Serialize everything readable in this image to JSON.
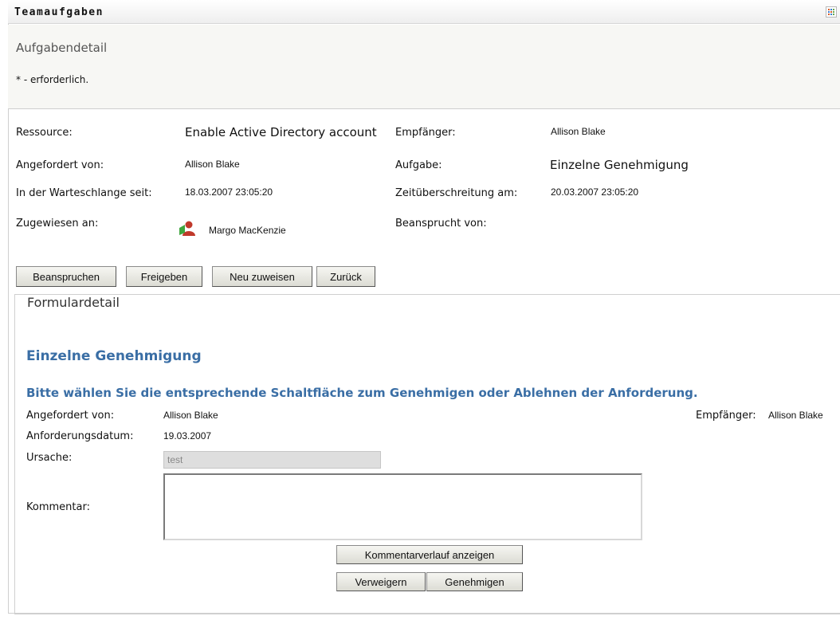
{
  "window": {
    "title": "Teamaufgaben",
    "menu_icon": "grid-menu-icon"
  },
  "header": {
    "heading": "Aufgabendetail",
    "required_note": "* - erforderlich."
  },
  "task": {
    "resource_label": "Ressource:",
    "resource_value": "Enable Active Directory account",
    "recipient_label": "Empfänger:",
    "recipient_value": "Allison Blake",
    "requested_by_label": "Angefordert von:",
    "requested_by_value": "Allison Blake",
    "task_label": "Aufgabe:",
    "task_value": "Einzelne Genehmigung",
    "queued_since_label": "In der Warteschlange seit:",
    "queued_since_value": "18.03.2007 23:05:20",
    "timeout_label": "Zeitüberschreitung am:",
    "timeout_value": "20.03.2007 23:05:20",
    "assigned_to_label": "Zugewiesen an:",
    "assigned_to_value": "Margo MacKenzie",
    "assigned_icon": "user-group-icon",
    "claimed_by_label": "Beansprucht von:",
    "claimed_by_value": ""
  },
  "actions": {
    "claim": "Beanspruchen",
    "release": "Freigeben",
    "reassign": "Neu zuweisen",
    "back": "Zurück"
  },
  "form": {
    "legend": "Formulardetail",
    "title": "Einzelne Genehmigung",
    "instruction": "Bitte wählen Sie die entsprechende Schaltfläche zum Genehmigen oder Ablehnen der Anforderung.",
    "requested_by_label": "Angefordert von:",
    "requested_by_value": "Allison Blake",
    "recipient_label": "Empfänger:",
    "recipient_value": "Allison Blake",
    "request_date_label": "Anforderungsdatum:",
    "request_date_value": "19.03.2007",
    "reason_label": "Ursache:",
    "reason_value": "test",
    "comment_label": "Kommentar:",
    "comment_value": "",
    "show_history": "Kommentarverlauf anzeigen",
    "deny": "Verweigern",
    "approve": "Genehmigen"
  },
  "colors": {
    "accent_blue": "#3a6ea5",
    "header_bg": "#f7f7f4"
  }
}
